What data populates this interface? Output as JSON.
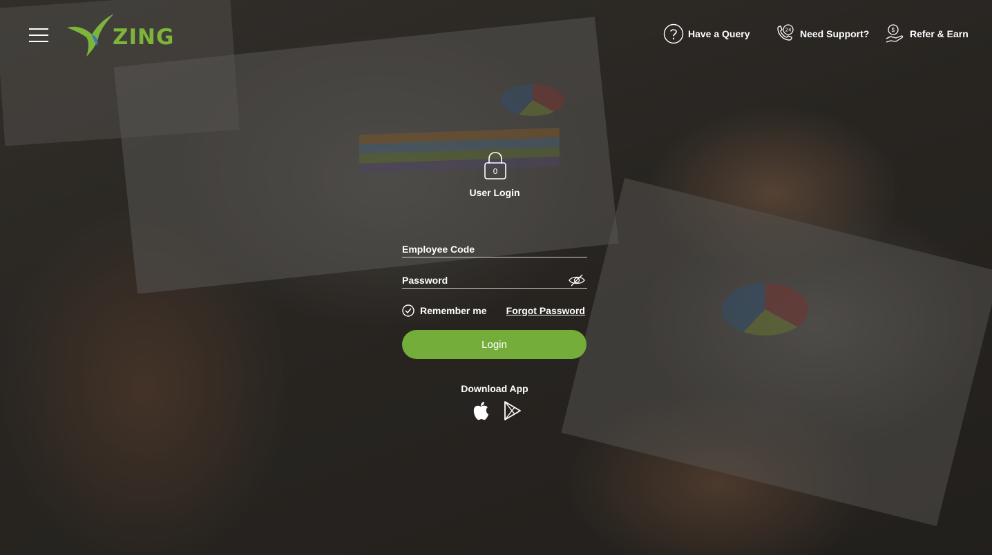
{
  "brand": {
    "logo_text": "ZING",
    "accent_color": "#74ad39"
  },
  "header": {
    "menu_icon": "hamburger-menu-icon",
    "links": [
      {
        "label": "Have a Query",
        "icon": "question-circle-icon"
      },
      {
        "label": "Need Support?",
        "icon": "phone-24-icon"
      },
      {
        "label": "Refer & Earn",
        "icon": "hand-coin-icon"
      }
    ]
  },
  "login": {
    "lock_icon": "padlock-icon",
    "lock_badge": "0",
    "title": "User Login",
    "employee_code_placeholder": "Employee Code",
    "password_placeholder": "Password",
    "password_toggle_icon": "eye-slash-icon",
    "remember_label": "Remember me",
    "forgot_label": "Forgot Password",
    "submit_label": "Login"
  },
  "download": {
    "title": "Download App",
    "stores": [
      {
        "icon": "apple-icon"
      },
      {
        "icon": "google-play-icon"
      }
    ]
  }
}
